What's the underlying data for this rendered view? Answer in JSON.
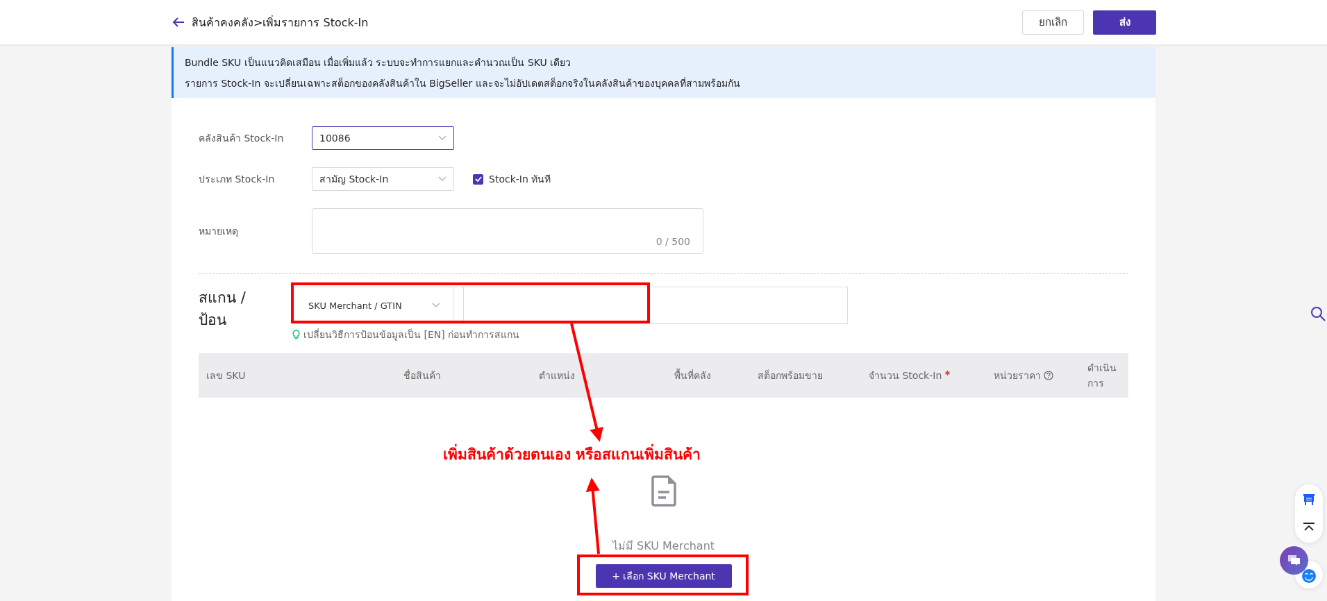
{
  "header": {
    "title": "สินค้าคงคลัง>เพิ่มรายการ Stock-In",
    "buttons": [
      {
        "label": "ยกเลิก",
        "kind": "secondary"
      },
      {
        "label": "ส่ง",
        "kind": "primary"
      }
    ]
  },
  "notice": {
    "lines": [
      "Bundle SKU เป็นแนวคิดเสมือน เมื่อเพิ่มแล้ว ระบบจะทำการแยกและคำนวณเป็น SKU เดียว",
      "รายการ Stock-In จะเปลี่ยนเฉพาะสต็อกของคลังสินค้าใน BigSeller และจะไม่อัปเดตสต็อกจริงในคลังสินค้าของบุคคลที่สามพร้อมกัน"
    ]
  },
  "form": {
    "warehouse": {
      "label": "คลังสินค้า Stock-In",
      "value": "10086",
      "focused": true
    },
    "type": {
      "label": "ประเภท Stock-In",
      "value": "สามัญ Stock-In",
      "focused": false
    },
    "instant": {
      "label": "Stock-In ทันที",
      "checked": true
    },
    "remark": {
      "label": "หมายเหตุ",
      "counter": "0 / 500"
    }
  },
  "scan": {
    "label": "สแกน / ป้อน",
    "mode": "SKU Merchant / GTIN",
    "hint": "เปลี่ยนวิธีการป้อนข้อมูลเป็น [EN] ก่อนทำการสแกน"
  },
  "table": {
    "columns": [
      {
        "label": "เลข SKU"
      },
      {
        "label": "ชื่อสินค้า"
      },
      {
        "label": "ตำแหน่ง"
      },
      {
        "label": "พื้นที่คลัง"
      },
      {
        "label": "สต็อกพร้อมขาย"
      },
      {
        "label": "จำนวน Stock-In",
        "required": true
      },
      {
        "label": "หน่วยราคา",
        "help": true
      },
      {
        "label": "ดำเนินการ"
      }
    ]
  },
  "empty": {
    "message": "ไม่มี SKU Merchant",
    "button": "+ เลือก SKU Merchant"
  },
  "annotation": {
    "text": "เพิ่มสินค้าด้วยตนเอง หรือสแกนเพิ่มสินค้า"
  }
}
